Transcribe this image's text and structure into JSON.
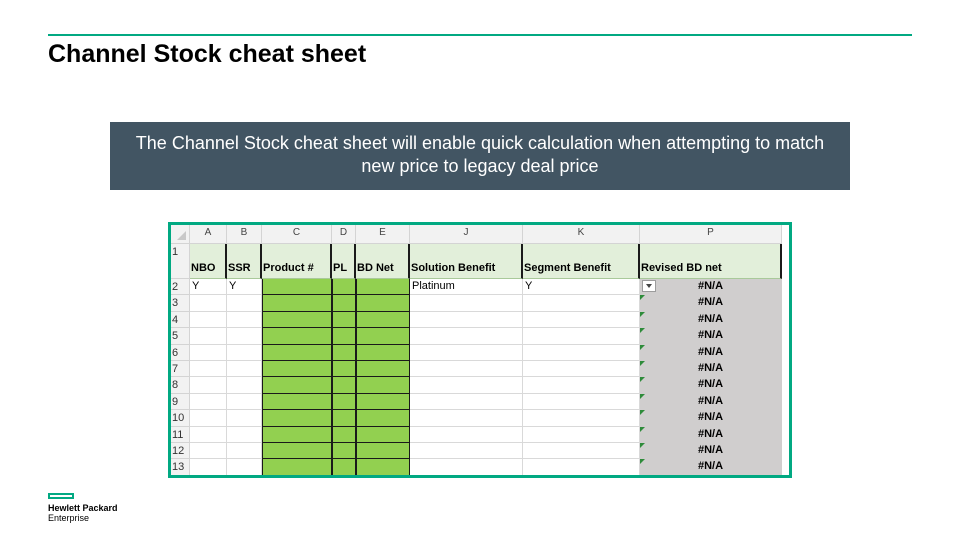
{
  "slide": {
    "title": "Channel Stock cheat sheet",
    "banner_text": "The Channel Stock cheat sheet will enable quick calculation when attempting to match new price to legacy deal price"
  },
  "sheet": {
    "columns": [
      "A",
      "B",
      "C",
      "D",
      "E",
      "J",
      "K",
      "P"
    ],
    "headers": [
      "NBO",
      "SSR",
      "Product #",
      "PL",
      "BD Net",
      "Solution Benefit",
      "Segment Benefit",
      "Revised BD net"
    ],
    "row_numbers": [
      "1",
      "2",
      "3",
      "4",
      "5",
      "6",
      "7",
      "8",
      "9",
      "10",
      "11",
      "12",
      "13"
    ],
    "row2": {
      "A": "Y",
      "B": "Y",
      "J": "Platinum",
      "K": "Y"
    },
    "error_value": "#N/A"
  },
  "logo": {
    "line1": "Hewlett Packard",
    "line2": "Enterprise"
  },
  "colors": {
    "accent": "#01a982",
    "banner": "#425563",
    "input_green": "#92d050",
    "header_green": "#e2efda",
    "output_gray": "#d0cece"
  }
}
